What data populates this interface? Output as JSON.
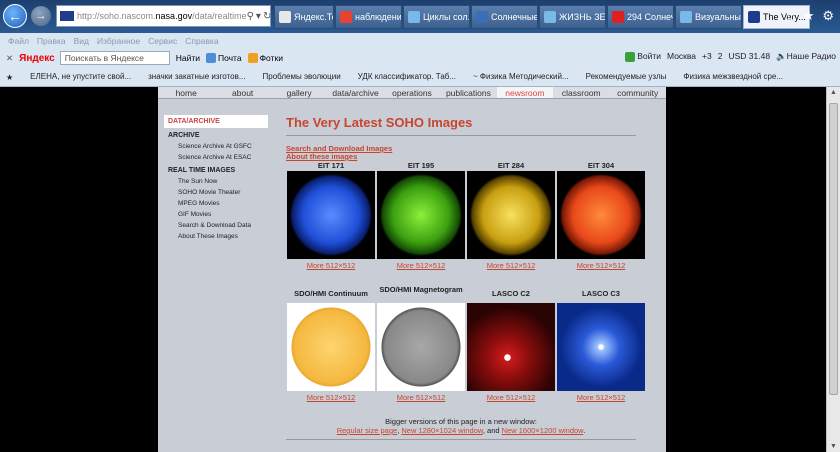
{
  "browser": {
    "url_prefix": "http://soho.nascom.",
    "url_domain": "nasa.gov",
    "url_suffix": "/data/realtime",
    "tabs": [
      {
        "label": "Яндекс.Тел...",
        "color": "#e8e8e8",
        "active": false
      },
      {
        "label": "наблюдени...",
        "color": "#e8432e",
        "active": false
      },
      {
        "label": "Циклы сол...",
        "color": "#7ab8e8",
        "active": false
      },
      {
        "label": "Солнечные...",
        "color": "#3a6fb8",
        "active": false
      },
      {
        "label": "ЖИЗНЬ ЗЕ...",
        "color": "#7ab8e8",
        "active": false
      },
      {
        "label": "294 Солнеч...",
        "color": "#e02020",
        "active": false
      },
      {
        "label": "Визуальны...",
        "color": "#7ab8e8",
        "active": false
      },
      {
        "label": "The Very...",
        "color": "#1f3d8c",
        "active": true
      }
    ],
    "menu": [
      "Файл",
      "Правка",
      "Вид",
      "Избранное",
      "Сервис",
      "Справка"
    ],
    "yandex": {
      "logo": "Яндекс",
      "search_placeholder": "Поискать в Яндексе",
      "find": "Найти",
      "mail": "Почта",
      "photos": "Фотки",
      "login": "Войти",
      "city": "Москва",
      "temp": "+3",
      "count": "2",
      "usd": "USD 31.48",
      "radio": "Наше Радио"
    },
    "favorites": [
      "ЕЛЕНА, не упустите свой...",
      "значки закатные изготов...",
      "Проблемы эволюции",
      "УДК классификатор. Таб...",
      "~ Физика Методический...",
      "Рекомендуемые узлы",
      "Физика межзвездной сре..."
    ]
  },
  "site": {
    "nav": [
      "home",
      "about",
      "gallery",
      "data/archive",
      "operations",
      "publications",
      "newsroom",
      "classroom",
      "community"
    ],
    "nav_active_index": 6,
    "left": {
      "head": "DATA/ARCHIVE",
      "archive": "ARCHIVE",
      "archive_links": [
        "Science Archive At GSFC",
        "Science Archive At ESAC"
      ],
      "realtime": "REAL TIME IMAGES",
      "realtime_links": [
        "The Sun Now",
        "SOHO Movie Theater",
        "MPEG Movies",
        "GIF Movies",
        "Search & Download Data",
        "About These Images"
      ]
    },
    "title": "The Very Latest SOHO Images",
    "link_search": "Search and Download Images",
    "link_about": "About these images",
    "row1": [
      {
        "caption": "EIT 171",
        "more": "More 512×512"
      },
      {
        "caption": "EIT 195",
        "more": "More 512×512"
      },
      {
        "caption": "EIT 284",
        "more": "More 512×512"
      },
      {
        "caption": "EIT 304",
        "more": "More 512×512"
      }
    ],
    "row2": [
      {
        "caption": "SDO/HMI Continuum",
        "more": "More 512×512"
      },
      {
        "caption": "SDO/HMI Magnetogram",
        "more": "More 512×512"
      },
      {
        "caption": "LASCO C2",
        "more": "More 512×512"
      },
      {
        "caption": "LASCO C3",
        "more": "More 512×512"
      }
    ],
    "bottom_line1": "Bigger versions of this page in a new window:",
    "bottom_regular": "Regular size page",
    "bottom_sep1": ", ",
    "bottom_1280": "New 1280×1024 window",
    "bottom_sep2": ", and ",
    "bottom_1600": "New 1600×1200 window",
    "bottom_end": "."
  }
}
